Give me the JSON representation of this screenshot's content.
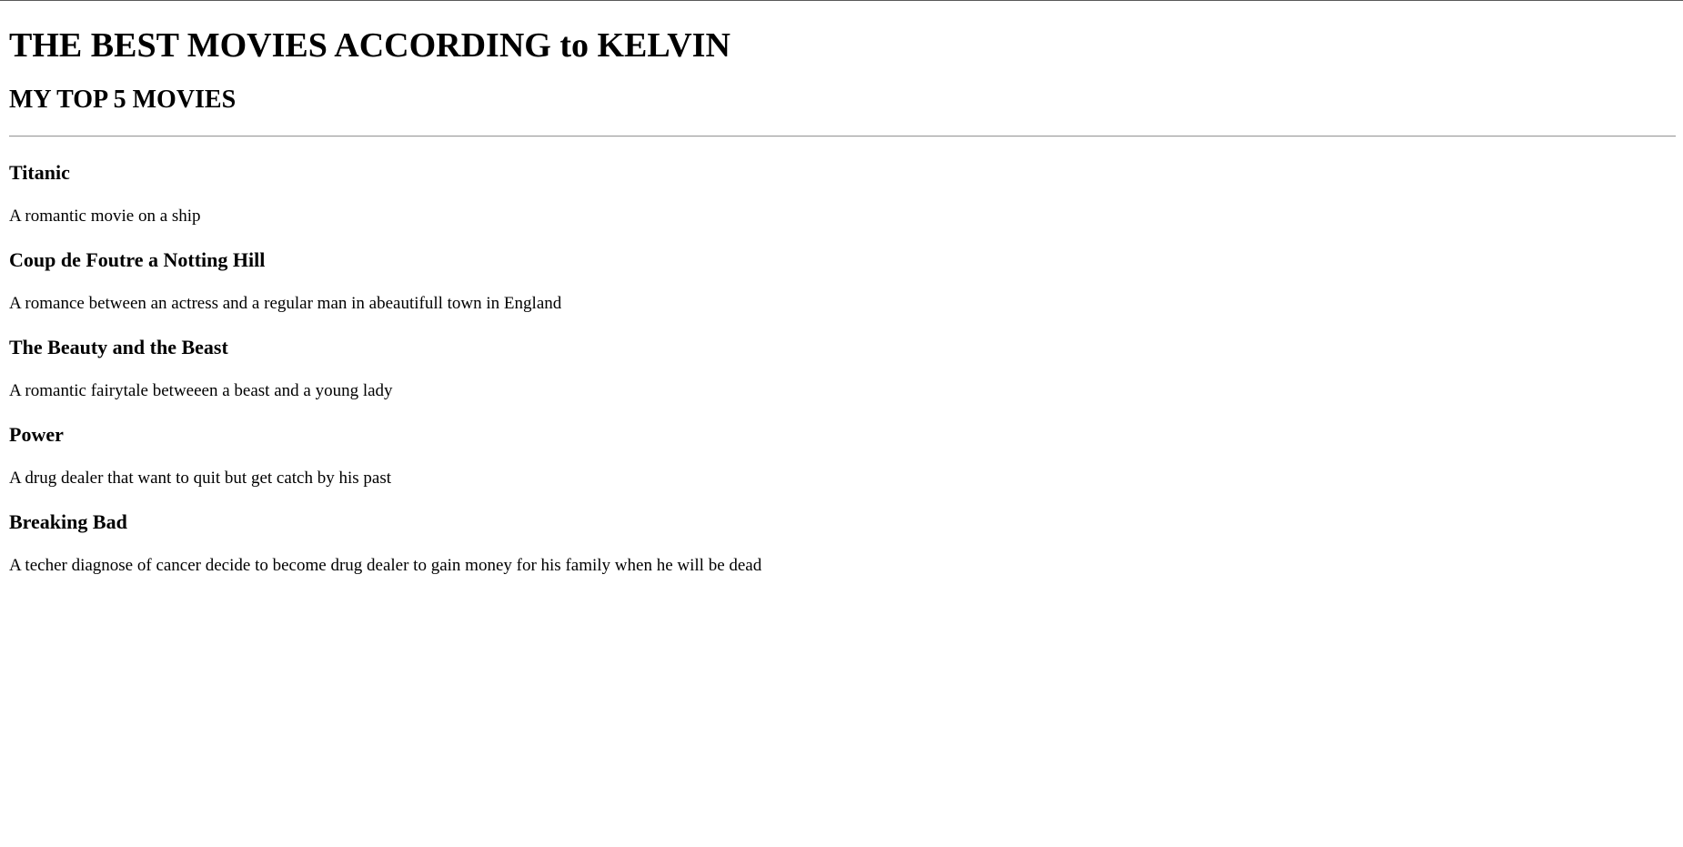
{
  "page": {
    "title": "THE BEST MOVIES ACCORDING to KELVIN",
    "subtitle": "MY TOP 5 MOVIES"
  },
  "movies": [
    {
      "title": "Titanic",
      "description": "A romantic movie on a ship"
    },
    {
      "title": "Coup de Foutre a Notting Hill",
      "description": "A romance between an actress and a regular man in abeautifull town in England"
    },
    {
      "title": "The Beauty and the Beast",
      "description": "A romantic fairytale betweeen a beast and a young lady"
    },
    {
      "title": "Power",
      "description": "A drug dealer that want to quit but get catch by his past"
    },
    {
      "title": "Breaking Bad",
      "description": "A techer diagnose of cancer decide to become drug dealer to gain money for his family when he will be dead"
    }
  ]
}
